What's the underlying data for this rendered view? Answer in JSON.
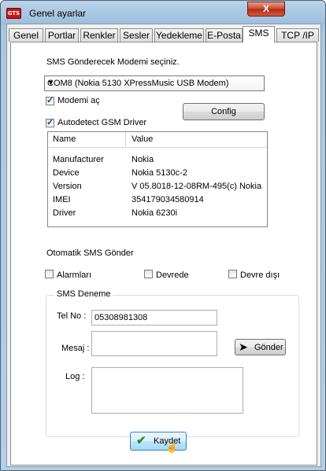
{
  "window": {
    "title": "Genel ayarlar",
    "icon_text": "GTS",
    "close_symbol": "X"
  },
  "tabs": [
    {
      "label": "Genel"
    },
    {
      "label": "Portlar"
    },
    {
      "label": "Renkler"
    },
    {
      "label": "Sesler"
    },
    {
      "label": "Yedekleme"
    },
    {
      "label": "E-Posta"
    },
    {
      "label": "SMS"
    },
    {
      "label": "TCP /IP"
    }
  ],
  "active_tab": "SMS",
  "sms": {
    "modem_prompt": "SMS Gönderecek Modemi seçiniz.",
    "modem_selected": "COM8 (Nokia 5130 XPressMusic USB Modem)",
    "modem_on_label": "Modemi  aç",
    "modem_on_checked": true,
    "config_label": "Config",
    "autodetect_label": "Autodetect GSM Driver",
    "autodetect_checked": true,
    "grid": {
      "col_name": "Name",
      "col_value": "Value",
      "rows": [
        {
          "name": "Manufacturer",
          "value": "Nokia"
        },
        {
          "name": "Device",
          "value": "Nokia 5130c-2"
        },
        {
          "name": "Version",
          "value": "V 05.8018-12-08RM-495(c) Nokia"
        },
        {
          "name": "IMEI",
          "value": "354179034580914"
        },
        {
          "name": "Driver",
          "value": "Nokia 6230i"
        }
      ]
    },
    "auto_send_label": "Otomatik  SMS Gönder",
    "alarms_label": "Alarmları",
    "alarms_checked": false,
    "on_circuit_label": "Devrede",
    "on_circuit_checked": false,
    "off_circuit_label": "Devre dışı",
    "off_circuit_checked": false,
    "test_group_title": "SMS Deneme",
    "tel_label": "Tel No :",
    "tel_value": "05308981308",
    "message_label": "Mesaj :",
    "message_value": "",
    "send_label": "Gönder",
    "log_label": "Log :",
    "log_value": ""
  },
  "save_label": "Kaydet",
  "colors": {
    "accent_check": "#2e8b2e",
    "titlebar": "#a8c7e2",
    "close": "#c8442c"
  }
}
